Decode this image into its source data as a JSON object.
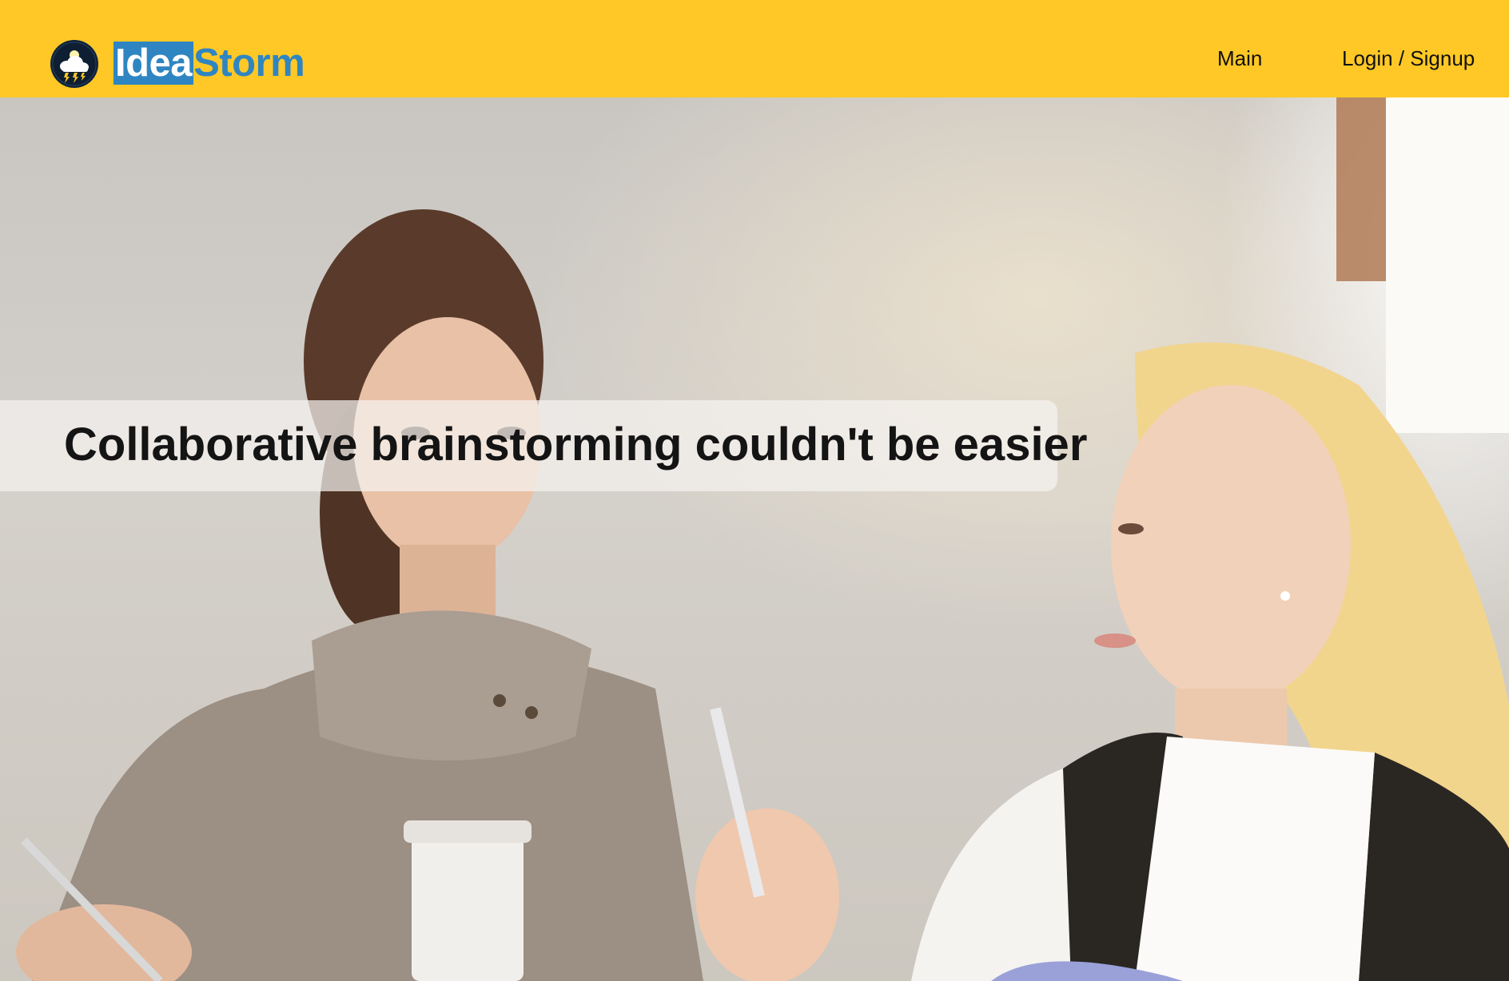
{
  "header": {
    "brand_part1": "Idea",
    "brand_part2": "Storm",
    "logo_icon": "lightbulb-storm-cloud-icon",
    "nav": [
      {
        "label": "Main"
      },
      {
        "label": "Login / Signup"
      }
    ],
    "background_color": "#ffc826",
    "brand_color": "#2f85c1"
  },
  "hero": {
    "tagline": "Collaborative brainstorming couldn't be easier",
    "photo": "two-women-talking-photo"
  }
}
